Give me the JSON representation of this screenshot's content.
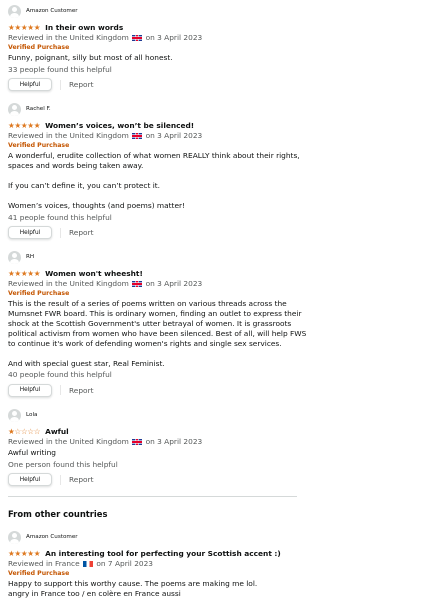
{
  "reviews": [
    {
      "profile_name": "Amazon Customer",
      "rating": 5,
      "title": "In their own words",
      "reviewed_in": "Reviewed in the United Kingdom",
      "date": "on 3 April 2023",
      "verified": "Verified Purchase",
      "body": [
        "Funny, poignant, silly but most of all honest."
      ],
      "helpful_count": "33 people found this helpful",
      "helpful_label": "Helpful",
      "report_label": "Report"
    },
    {
      "profile_name": "Rachel F.",
      "rating": 5,
      "title": "Women’s voices, won’t be silenced!",
      "reviewed_in": "Reviewed in the United Kingdom",
      "date": "on 3 April 2023",
      "verified": "Verified Purchase",
      "body": [
        "A wonderful, erudite collection of what women REALLY think about their rights,",
        "spaces and words being taken away.",
        "",
        "If you can’t define it, you can’t protect it.",
        "",
        "Women’s voices, thoughts (and poems) matter!"
      ],
      "helpful_count": "41 people found this helpful",
      "helpful_label": "Helpful",
      "report_label": "Report"
    },
    {
      "profile_name": "RH",
      "rating": 5,
      "title": "Women won't wheesht!",
      "reviewed_in": "Reviewed in the United Kingdom",
      "date": "on 3 April 2023",
      "verified": "Verified Purchase",
      "body": [
        "This is the result of a series of poems written on various threads across the",
        "Mumsnet FWR board. This is ordinary women, finding an outlet to express their",
        "shock at the Scottish Government's utter betrayal of women. It is grassroots",
        "political activism from women who have been silenced. Best of all, will help FWS",
        "to continue it's work of defending women's rights and single sex services.",
        "",
        "And with special guest star, Real Feminist."
      ],
      "helpful_count": "40 people found this helpful",
      "helpful_label": "Helpful",
      "report_label": "Report"
    },
    {
      "profile_name": "Lola",
      "rating": 1,
      "title": "Awful",
      "reviewed_in": "Reviewed in the United Kingdom",
      "date": "on 3 April 2023",
      "verified": "",
      "body": [
        "Awful writing"
      ],
      "helpful_count": "One person found this helpful",
      "helpful_label": "Helpful",
      "report_label": "Report"
    }
  ],
  "other_countries": {
    "heading": "From other countries",
    "review": {
      "profile_name": "Amazon Customer",
      "rating": 5,
      "title": "An interesting tool for perfecting your Scottish accent :)",
      "reviewed_in": "Reviewed in France",
      "date": "on 7 April 2023",
      "verified": "Verified Purchase",
      "body": [
        "Happy to support this worthy cause. The poems are making me lol.",
        "angry in France too / en colère en France aussi"
      ]
    }
  },
  "colors": {
    "star": "#de7921",
    "verified": "#c45500",
    "meta": "#565959",
    "text": "#0f1111"
  },
  "icons": {
    "avatar": "default-profile-avatar-icon",
    "star_full": "star-filled-icon",
    "star_empty": "star-empty-icon",
    "flag_uk": "uk-flag-icon",
    "flag_fr": "france-flag-icon"
  }
}
